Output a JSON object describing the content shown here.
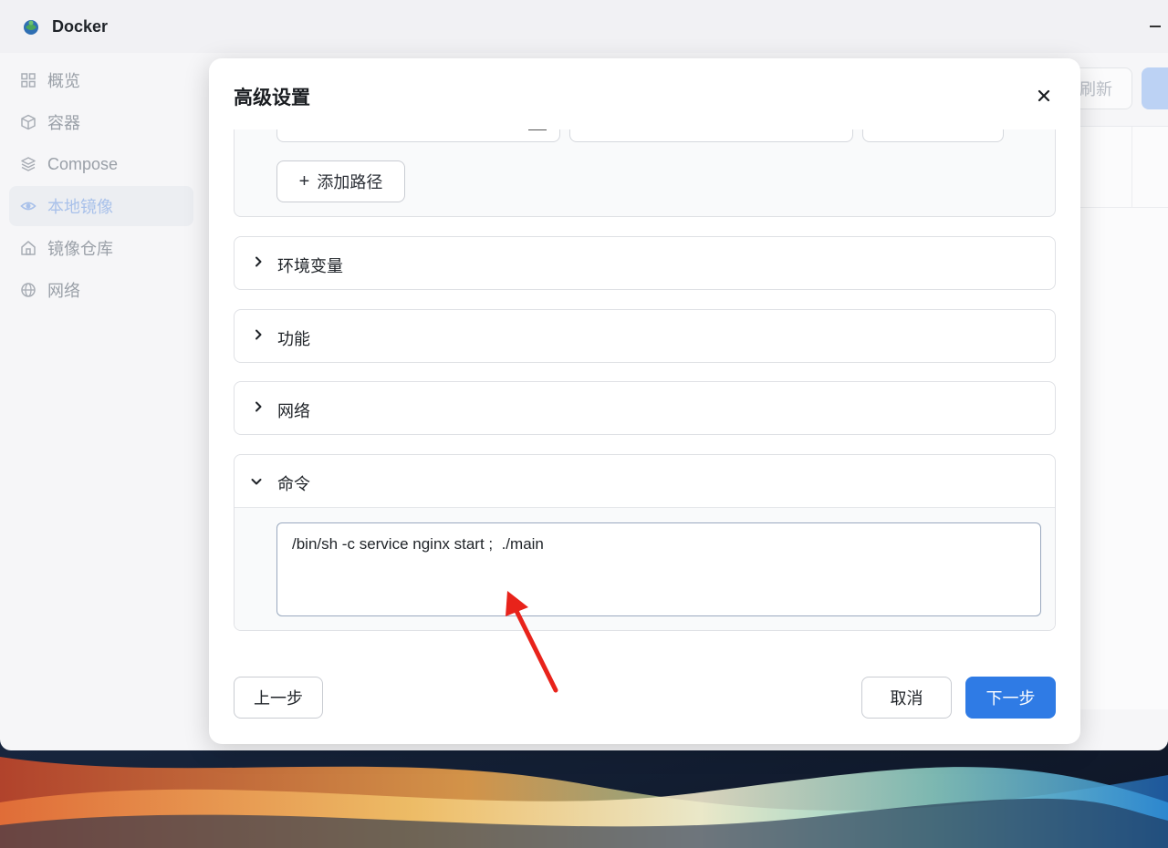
{
  "app": {
    "title": "Docker",
    "logo_icon": "docker-whale-icon"
  },
  "sidebar": {
    "items": [
      {
        "label": "概览",
        "icon": "grid-icon",
        "active": false
      },
      {
        "label": "容器",
        "icon": "cube-icon",
        "active": false
      },
      {
        "label": "Compose",
        "icon": "layers-icon",
        "active": false
      },
      {
        "label": "本地镜像",
        "icon": "eye-icon",
        "active": true
      },
      {
        "label": "镜像仓库",
        "icon": "home-icon",
        "active": false
      },
      {
        "label": "网络",
        "icon": "globe-icon",
        "active": false
      }
    ]
  },
  "background": {
    "refresh_label": "刷新"
  },
  "modal": {
    "title": "高级设置",
    "volumes": {
      "add_path_label": "添加路径"
    },
    "sections": [
      {
        "label": "环境变量",
        "expanded": false
      },
      {
        "label": "功能",
        "expanded": false
      },
      {
        "label": "网络",
        "expanded": false
      }
    ],
    "command": {
      "label": "命令",
      "expanded": true,
      "value": "/bin/sh -c service nginx start ;  ./main"
    },
    "footer": {
      "prev_label": "上一步",
      "cancel_label": "取消",
      "next_label": "下一步"
    }
  },
  "colors": {
    "primary": "#2f7be5",
    "active_nav": "#a9c1ea",
    "annotation_arrow": "#e8231b"
  }
}
